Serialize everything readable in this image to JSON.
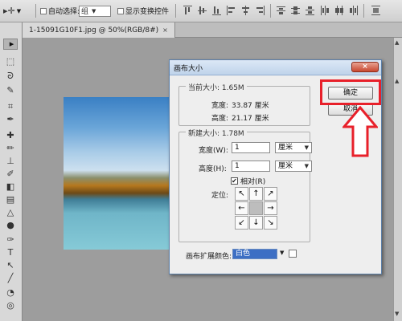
{
  "options_bar": {
    "auto_select_label": "自动选择:",
    "auto_select_value": "组",
    "show_transform_label": "显示变换控件"
  },
  "document": {
    "tab_title": "1-15091G10F1.jpg @ 50%(RGB/8#)",
    "tab_close": "×"
  },
  "dialog": {
    "title": "画布大小",
    "close_glyph": "×",
    "ok_label": "确定",
    "cancel_label": "取消",
    "current_size": {
      "legend": "当前大小: 1.65M",
      "width_label": "宽度:",
      "width_value": "33.87 厘米",
      "height_label": "高度:",
      "height_value": "21.17 厘米"
    },
    "new_size": {
      "legend": "新建大小: 1.78M",
      "width_label": "宽度(W):",
      "width_value": "1",
      "width_unit": "厘米",
      "height_label": "高度(H):",
      "height_value": "1",
      "height_unit": "厘米",
      "relative_label": "相对(R)",
      "relative_checked": true,
      "anchor_label": "定位:",
      "anchor_glyphs": [
        "↖",
        "↑",
        "↗",
        "←",
        "",
        "→",
        "↙",
        "↓",
        "↘"
      ]
    },
    "extension_color_label": "画布扩展颜色:",
    "extension_color_value": "白色"
  },
  "colors": {
    "highlight": "#e8202a",
    "title_bar": "#bfd3ea",
    "close_button": "#c8472f",
    "color_select": "#3d6fc4"
  }
}
